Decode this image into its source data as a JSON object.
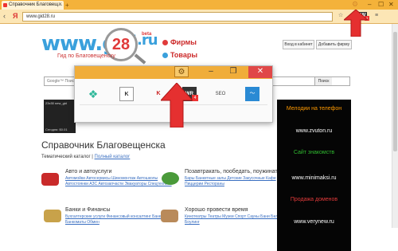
{
  "browser": {
    "tab_title": "Справочник Благовещ...",
    "new_tab_label": "+",
    "url": "www.gid28.ru",
    "nav_back": "‹",
    "nav_forward": "›",
    "yandex_label": "Я",
    "window_min": "–",
    "window_max": "☐",
    "window_close": "✕",
    "toolbar_badge": "4"
  },
  "site": {
    "logo_text": "www.gid",
    "logo_number": "28",
    "logo_suffix": ".ru",
    "beta_label": "beta",
    "tagline": "Гид по Благовещенску",
    "nav": [
      {
        "label": "Фирмы",
        "color": "#e03a3a"
      },
      {
        "label": "Товары",
        "color": "#3aa0dc"
      }
    ],
    "login_button": "Вход в кабинет",
    "add_firm_button": "Добавить фирму",
    "search_placeholder": "Google™ Поиск",
    "search_button": "Поиск",
    "thumb_title": "23x30 new_gid",
    "thumb_caption": "Сегодня: $0.01",
    "section_title": "Справочник Благовещенска",
    "subnav_label": "Тематический каталог",
    "subnav_link": "Полный каталог",
    "categories": [
      {
        "title": "Авто и автоуслуги",
        "links": "Автомойки Автосервисы Шиномонтаж Автошколы Автостоянки АЗС Автозапчасти Эвакуаторы Спецтехника",
        "icon": "car-icon"
      },
      {
        "title": "Позавтракать, пообедать, поужинать",
        "links": "Бары Банкетные залы Детские Закусочные Кафе Пиццерии Рестораны",
        "icon": "food-icon"
      },
      {
        "title": "Банки и Финансы",
        "links": "Бухгалтерские услуги Финансовый консалтинг Банки Банкоматы Обмен",
        "icon": "money-icon"
      },
      {
        "title": "Хорошо провести время",
        "links": "Кинотеатры Театры Музеи Спорт Сауны Бани Бильярд Боулинг",
        "icon": "leisure-icon"
      }
    ],
    "ad_lines": [
      {
        "text": "Мелодии на телефон",
        "color": "#ff9a00"
      },
      {
        "text": "www.zvuton.ru",
        "color": "#ffffff"
      },
      {
        "text": "Сайт знакомств",
        "color": "#2fb82f"
      },
      {
        "text": "www.minimaksi.ru",
        "color": "#ffffff"
      },
      {
        "text": "Продажа доменов",
        "color": "#e03a3a"
      },
      {
        "text": "www.verynew.ru",
        "color": "#ffffff"
      }
    ]
  },
  "overlay": {
    "gear_icon": "gear-icon",
    "minimize": "–",
    "restore": "❐",
    "close": "✕",
    "icons": [
      "cubes-icon",
      "k-icon",
      "kaspersky-icon",
      "wr-icon",
      "seo-icon",
      "chart-icon"
    ],
    "icon_labels": [
      "",
      "K",
      "K",
      "WR",
      "SEO",
      ""
    ],
    "wr_badge": "4"
  },
  "colors": {
    "chrome": "#f4b23a",
    "overlay_bar": "#f0ad3a",
    "close_red": "#e04848",
    "arrow_red": "#e53030",
    "link_blue": "#3a6fc1"
  }
}
